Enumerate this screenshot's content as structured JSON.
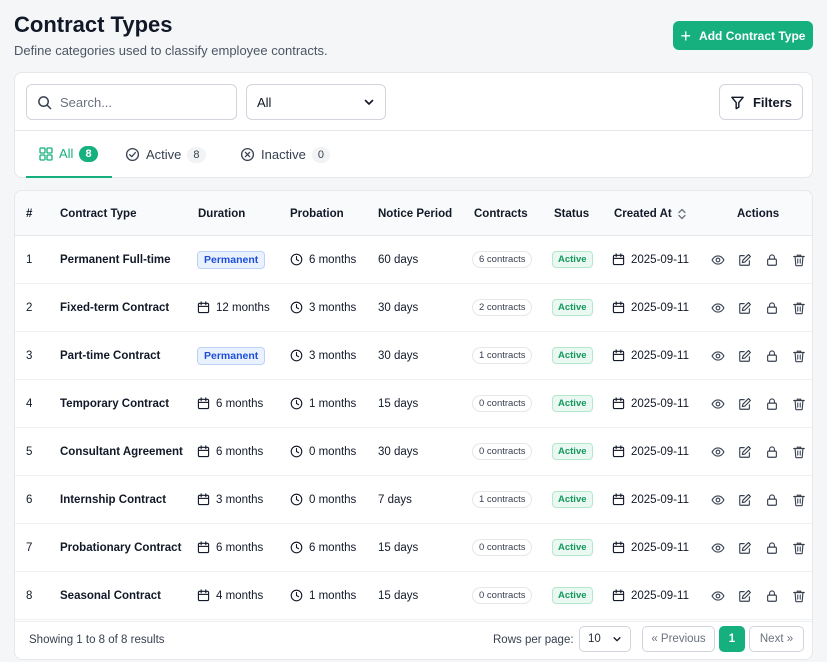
{
  "header": {
    "title": "Contract Types",
    "subtitle": "Define categories used to classify employee contracts.",
    "add_button_label": "Add Contract Type"
  },
  "toolbar": {
    "search_placeholder": "Search...",
    "status_select_value": "All",
    "filters_label": "Filters"
  },
  "tabs": [
    {
      "label": "All",
      "count": "8",
      "active": true
    },
    {
      "label": "Active",
      "count": "8",
      "active": false
    },
    {
      "label": "Inactive",
      "count": "0",
      "active": false
    }
  ],
  "table": {
    "columns": [
      "#",
      "Contract Type",
      "Duration",
      "Probation",
      "Notice Period",
      "Contracts",
      "Status",
      "Created At",
      "Actions"
    ],
    "rows": [
      {
        "num": "1",
        "name": "Permanent Full-time",
        "duration": "Permanent",
        "duration_type": "badge",
        "probation": "6 months",
        "notice": "60 days",
        "contracts": "6 contracts",
        "status": "Active",
        "created": "2025-09-11"
      },
      {
        "num": "2",
        "name": "Fixed-term Contract",
        "duration": "12 months",
        "duration_type": "text",
        "probation": "3 months",
        "notice": "30 days",
        "contracts": "2 contracts",
        "status": "Active",
        "created": "2025-09-11"
      },
      {
        "num": "3",
        "name": "Part-time Contract",
        "duration": "Permanent",
        "duration_type": "badge",
        "probation": "3 months",
        "notice": "30 days",
        "contracts": "1 contracts",
        "status": "Active",
        "created": "2025-09-11"
      },
      {
        "num": "4",
        "name": "Temporary Contract",
        "duration": "6 months",
        "duration_type": "text",
        "probation": "1 months",
        "notice": "15 days",
        "contracts": "0 contracts",
        "status": "Active",
        "created": "2025-09-11"
      },
      {
        "num": "5",
        "name": "Consultant Agreement",
        "duration": "6 months",
        "duration_type": "text",
        "probation": "0 months",
        "notice": "30 days",
        "contracts": "0 contracts",
        "status": "Active",
        "created": "2025-09-11"
      },
      {
        "num": "6",
        "name": "Internship Contract",
        "duration": "3 months",
        "duration_type": "text",
        "probation": "0 months",
        "notice": "7 days",
        "contracts": "1 contracts",
        "status": "Active",
        "created": "2025-09-11"
      },
      {
        "num": "7",
        "name": "Probationary Contract",
        "duration": "6 months",
        "duration_type": "text",
        "probation": "6 months",
        "notice": "15 days",
        "contracts": "0 contracts",
        "status": "Active",
        "created": "2025-09-11"
      },
      {
        "num": "8",
        "name": "Seasonal Contract",
        "duration": "4 months",
        "duration_type": "text",
        "probation": "1 months",
        "notice": "15 days",
        "contracts": "0 contracts",
        "status": "Active",
        "created": "2025-09-11"
      }
    ]
  },
  "footer": {
    "showing": "Showing 1 to 8 of 8 results",
    "rows_per_page_label": "Rows per page:",
    "rows_per_page_value": "10",
    "previous_label": "« Previous",
    "current_page": "1",
    "next_label": "Next »"
  },
  "colors": {
    "accent": "#16b07e",
    "permanent_badge": "#1d4ed8",
    "active_badge": "#15965f"
  },
  "icons": {
    "add": "plus-icon",
    "search": "search-icon",
    "select": "chevron-down-icon",
    "filters": "filter-icon",
    "tab_all": "grid-icon",
    "tab_active": "check-circle-icon",
    "tab_inactive": "x-circle-icon",
    "sort": "sort-icon",
    "duration": "calendar-icon",
    "probation": "clock-icon",
    "created": "calendar-icon",
    "actions": [
      "eye-icon",
      "edit-icon",
      "lock-icon",
      "trash-icon"
    ]
  }
}
